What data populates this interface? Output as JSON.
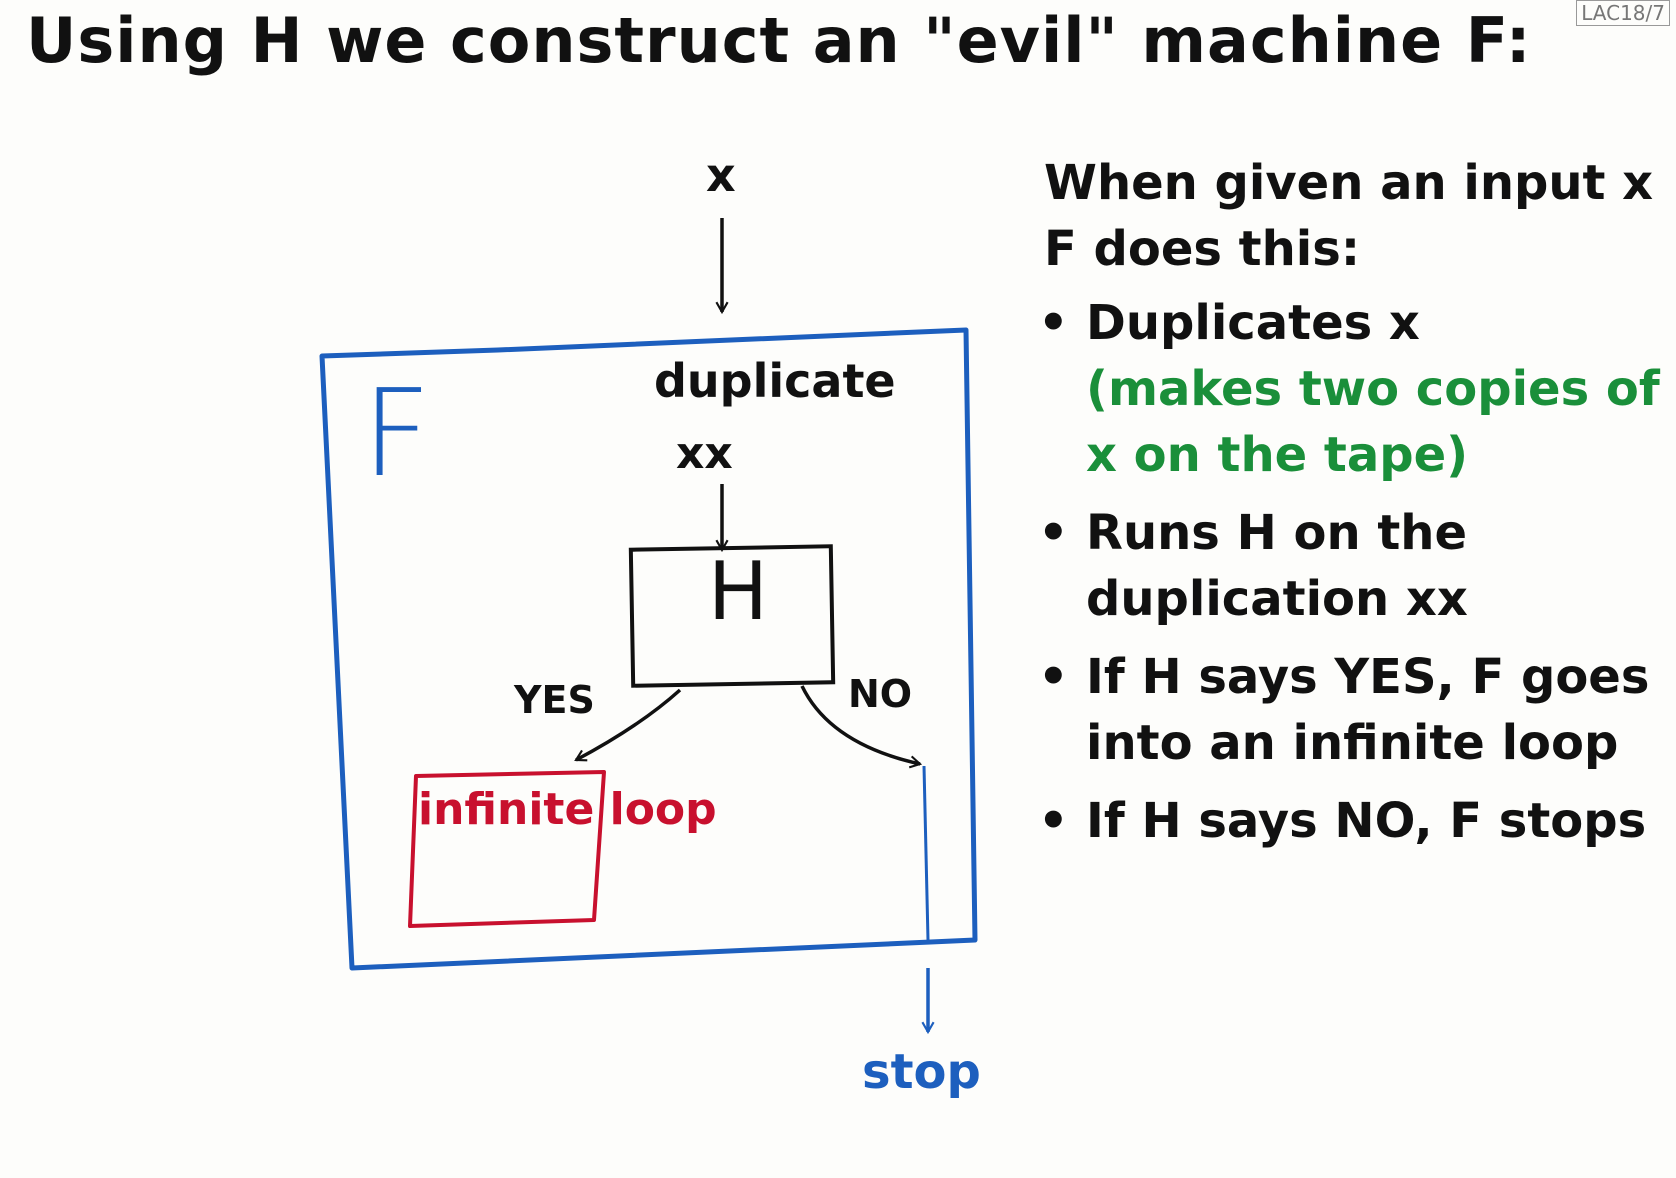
{
  "title": "Using H we construct an \"evil\" machine F:",
  "page_code": "LAC18/7",
  "diagram": {
    "input": "x",
    "machine": "F",
    "duplicate": "duplicate",
    "doubled_input": "xx",
    "decider": "H",
    "yes": "YES",
    "no": "NO",
    "loop": "infinite loop",
    "stop": "stop"
  },
  "explanation": {
    "intro": "When given an input x F does this:",
    "steps": [
      {
        "text": "Duplicates x",
        "note": "(makes two copies of x on the tape)"
      },
      {
        "text": "Runs H on the duplication xx"
      },
      {
        "text": "If H says YES, F goes into an infinite loop"
      },
      {
        "text": "If H says NO, F stops"
      }
    ]
  },
  "colors": {
    "ink": "#111111",
    "machine_blue": "#1d5fbe",
    "loop_red": "#c8102e",
    "note_green": "#1a8f3a"
  }
}
